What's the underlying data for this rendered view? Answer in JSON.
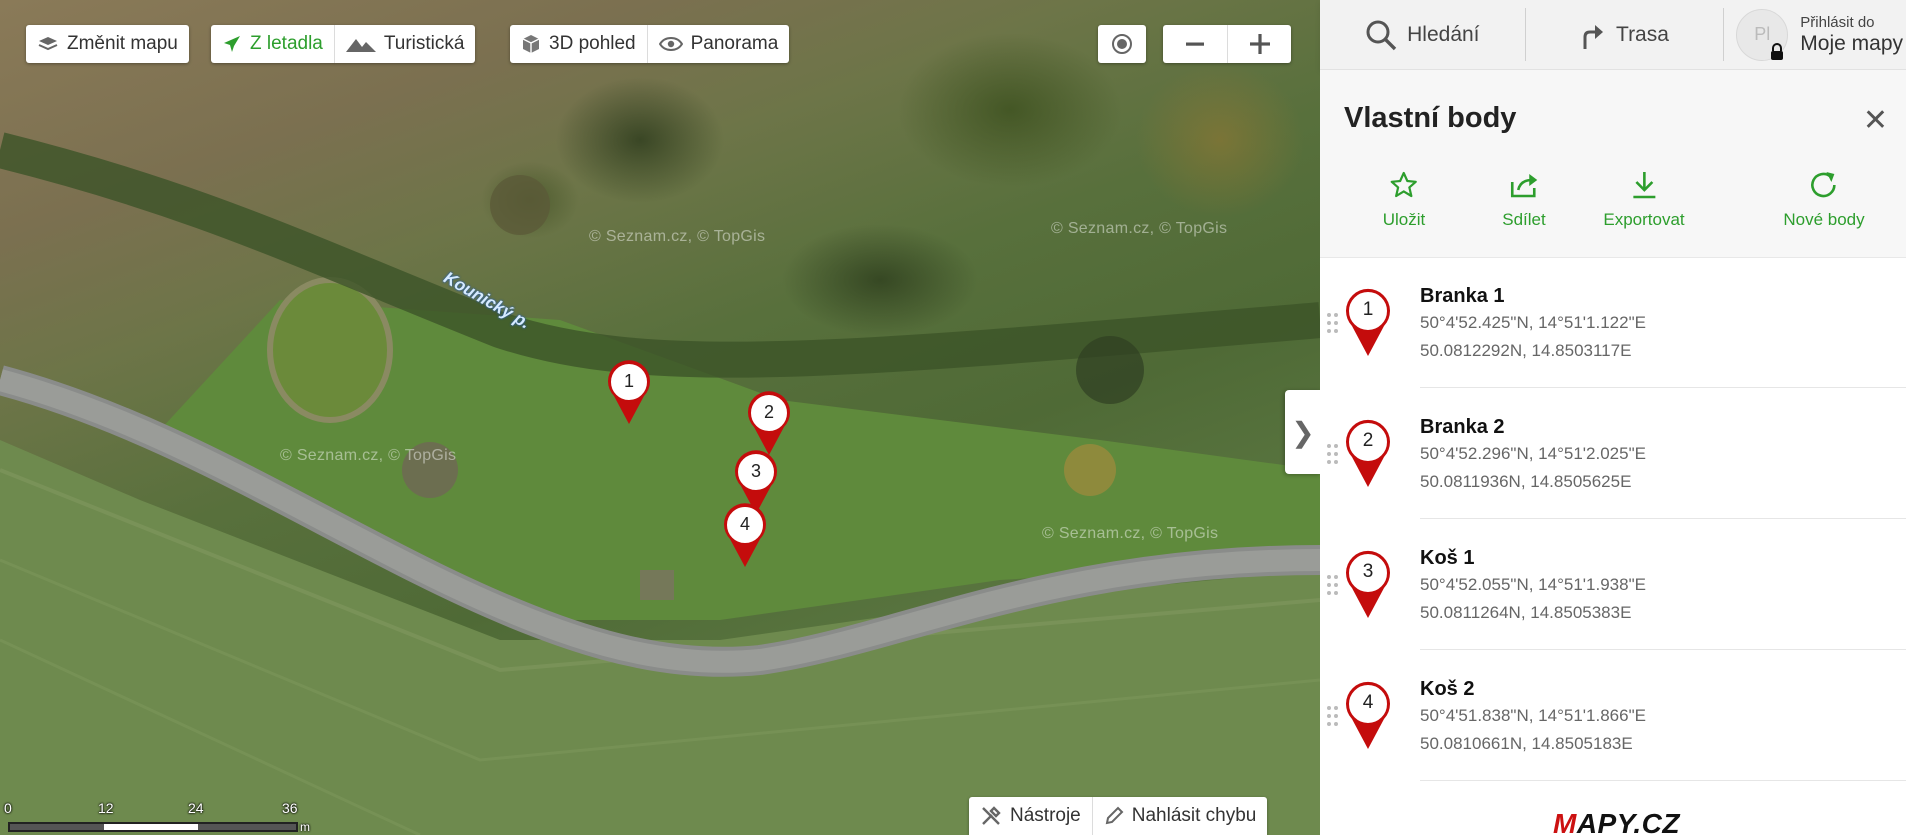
{
  "map": {
    "toolbar": {
      "change_map": "Změnit mapu",
      "aerial": "Z letadla",
      "tourist": "Turistická",
      "view3d": "3D pohled",
      "panorama": "Panorama"
    },
    "watermark": "© Seznam.cz, © TopGis",
    "stream_label": "Kounický p.",
    "pins": [
      "1",
      "2",
      "3",
      "4"
    ],
    "scale": {
      "labels": [
        "0",
        "12",
        "24",
        "36"
      ],
      "unit": "m"
    },
    "bottom": {
      "tools": "Nástroje",
      "report": "Nahlásit chybu"
    },
    "side_toggle": "❯"
  },
  "topbar": {
    "search": "Hledání",
    "route": "Trasa",
    "avatar_initials": "Pl",
    "login_small": "Přihlásit do",
    "login_big": "Moje mapy"
  },
  "panel": {
    "title": "Vlastní body",
    "close": "✕",
    "actions": {
      "save": "Uložit",
      "share": "Sdílet",
      "export": "Exportovat",
      "new": "Nové body"
    },
    "points": [
      {
        "num": "1",
        "name": "Branka 1",
        "dms": "50°4'52.425\"N, 14°51'1.122\"E",
        "dec": "50.0812292N, 14.8503117E"
      },
      {
        "num": "2",
        "name": "Branka 2",
        "dms": "50°4'52.296\"N, 14°51'2.025\"E",
        "dec": "50.0811936N, 14.8505625E"
      },
      {
        "num": "3",
        "name": "Koš 1",
        "dms": "50°4'52.055\"N, 14°51'1.938\"E",
        "dec": "50.0811264N, 14.8505383E"
      },
      {
        "num": "4",
        "name": "Koš 2",
        "dms": "50°4'51.838\"N, 14°51'1.866\"E",
        "dec": "50.0810661N, 14.8505183E"
      }
    ]
  },
  "logo": {
    "first": "M",
    "rest": "APY.CZ"
  },
  "colors": {
    "accent": "#2d9e2d",
    "pin": "#c40c0c"
  }
}
